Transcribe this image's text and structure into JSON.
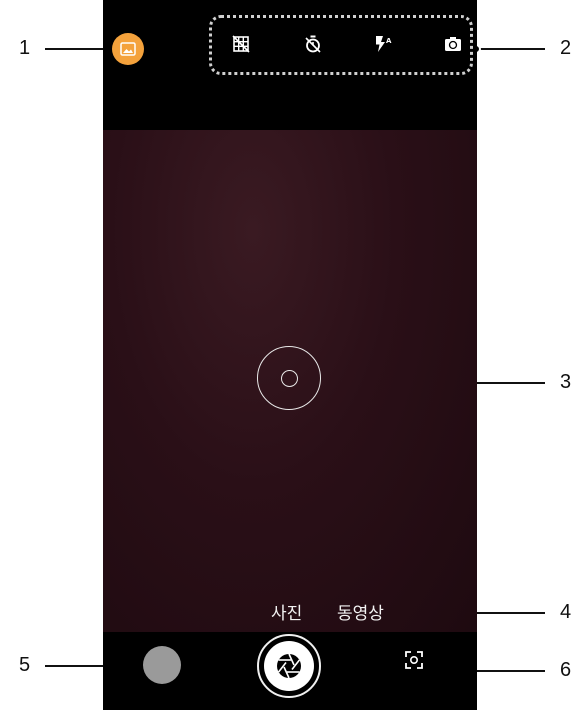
{
  "callouts": [
    {
      "number": "1",
      "target": "gallery-icon"
    },
    {
      "number": "2",
      "target": "top-toolbar"
    },
    {
      "number": "3",
      "target": "focus-indicator"
    },
    {
      "number": "4",
      "target": "mode-selector"
    },
    {
      "number": "5",
      "target": "last-photo-thumbnail"
    },
    {
      "number": "6",
      "target": "shutter-button"
    }
  ],
  "toolbar": {
    "icons": [
      "grid-icon",
      "timer-icon",
      "flash-auto-icon",
      "switch-camera-icon"
    ]
  },
  "modes": {
    "photo": "사진",
    "video": "동영상"
  },
  "bottom": {
    "shutter_icon": "aperture-icon",
    "lens_icon": "focus-frame-icon"
  },
  "colors": {
    "gallery_accent": "#f4a23c",
    "viewfinder": "#2a0f17",
    "thumbnail": "#9a9a9a"
  }
}
